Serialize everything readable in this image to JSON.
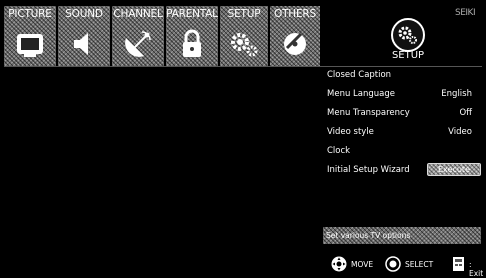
{
  "tabs": [
    {
      "label": "PICTURE",
      "icon": "tv-icon"
    },
    {
      "label": "SOUND",
      "icon": "speaker-icon"
    },
    {
      "label": "CHANNEL",
      "icon": "satellite-dish-icon"
    },
    {
      "label": "PARENTAL",
      "icon": "lock-icon"
    },
    {
      "label": "SETUP",
      "icon": "gears-icon"
    },
    {
      "label": "OTHERS",
      "icon": "disc-icon"
    }
  ],
  "active_section": {
    "title": "SETUP",
    "icon": "gears-icon"
  },
  "brand": "SEIKI",
  "menu": {
    "closed_caption": {
      "label": "Closed Caption"
    },
    "menu_language": {
      "label": "Menu Language",
      "value": "English"
    },
    "menu_transparency": {
      "label": "Menu Transparency",
      "value": "Off"
    },
    "video_style": {
      "label": "Video style",
      "value": "Video"
    },
    "clock": {
      "label": "Clock"
    },
    "initial_setup_wizard": {
      "label": "Initial Setup Wizard",
      "button": "Execute"
    }
  },
  "status": "Set various TV options",
  "hints": {
    "move": "MOVE",
    "select": "SELECT",
    "exit": ": Exit"
  }
}
